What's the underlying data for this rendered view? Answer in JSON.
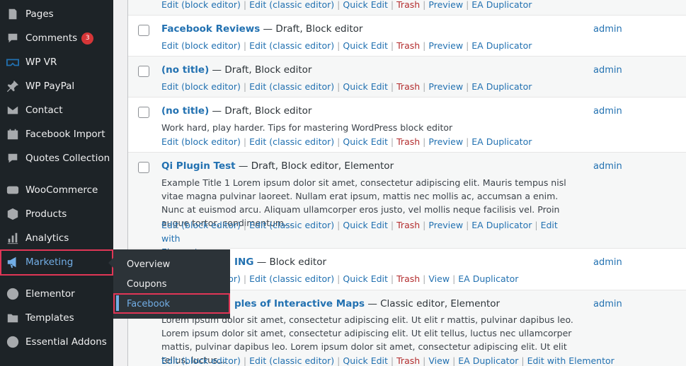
{
  "sidebar": {
    "items": [
      {
        "label": "Pages",
        "icon": "pages-icon"
      },
      {
        "label": "Comments",
        "icon": "comments-icon",
        "badge": "3"
      },
      {
        "label": "WP VR",
        "icon": "vr-icon"
      },
      {
        "label": "WP PayPal",
        "icon": "pin-icon"
      },
      {
        "label": "Contact",
        "icon": "mail-icon"
      },
      {
        "label": "Facebook Import",
        "icon": "calendar-icon"
      },
      {
        "label": "Quotes Collection",
        "icon": "quote-icon"
      },
      {
        "label": "WooCommerce",
        "icon": "woo-icon"
      },
      {
        "label": "Products",
        "icon": "box-icon"
      },
      {
        "label": "Analytics",
        "icon": "chart-icon"
      },
      {
        "label": "Marketing",
        "icon": "megaphone-icon"
      },
      {
        "label": "Elementor",
        "icon": "elementor-icon"
      },
      {
        "label": "Templates",
        "icon": "folder-icon"
      },
      {
        "label": "Essential Addons",
        "icon": "ea-icon"
      }
    ]
  },
  "flyout": {
    "items": [
      "Overview",
      "Coupons",
      "Facebook"
    ]
  },
  "actions": {
    "edit_block": "Edit (block editor)",
    "edit_classic": "Edit (classic editor)",
    "quick_edit": "Quick Edit",
    "trash": "Trash",
    "preview": "Preview",
    "view": "View",
    "ea_dup": "EA Duplicator",
    "edit_with_elementor": "Edit with Elementor",
    "edit_with": "Edit with",
    "elementor": "Elementor",
    "sep": "|"
  },
  "posts": [
    {
      "title": "Facebook Reviews",
      "state": " — Draft, Block editor",
      "author": "admin"
    },
    {
      "title": "(no title)",
      "state": " — Draft, Block editor",
      "author": "admin"
    },
    {
      "title": "(no title)",
      "state": " — Draft, Block editor",
      "author": "admin",
      "excerpt": "Work hard, play harder. Tips for mastering WordPress block editor"
    },
    {
      "title": "Qi Plugin Test",
      "state": " — Draft, Block editor, Elementor",
      "author": "admin",
      "excerpt": "Example Title 1 Lorem ipsum dolor sit amet, consectetur adipiscing elit. Mauris tempus nisl vitae magna pulvinar laoreet. Nullam erat ipsum, mattis nec mollis ac, accumsan a enim. Nunc at euismod arcu. Aliquam ullamcorper eros justo, vel mollis neque facilisis vel. Proin augue tortor, condimentum..."
    },
    {
      "title": "ING",
      "state": " — Block editor",
      "author": "admin"
    },
    {
      "title": "ples of Interactive Maps",
      "state": " — Classic editor, Elementor",
      "author": "admin",
      "excerpt": "Lorem ipsum dolor sit amet, consectetur adipiscing elit. Ut elit r mattis, pulvinar dapibus leo. Lorem ipsum dolor sit amet, consectetur adipiscing elit. Ut elit tellus, luctus nec ullamcorper mattis, pulvinar dapibus leo. Lorem ipsum dolor sit amet, consectetur adipiscing elit. Ut elit tellus, luctus..."
    }
  ]
}
